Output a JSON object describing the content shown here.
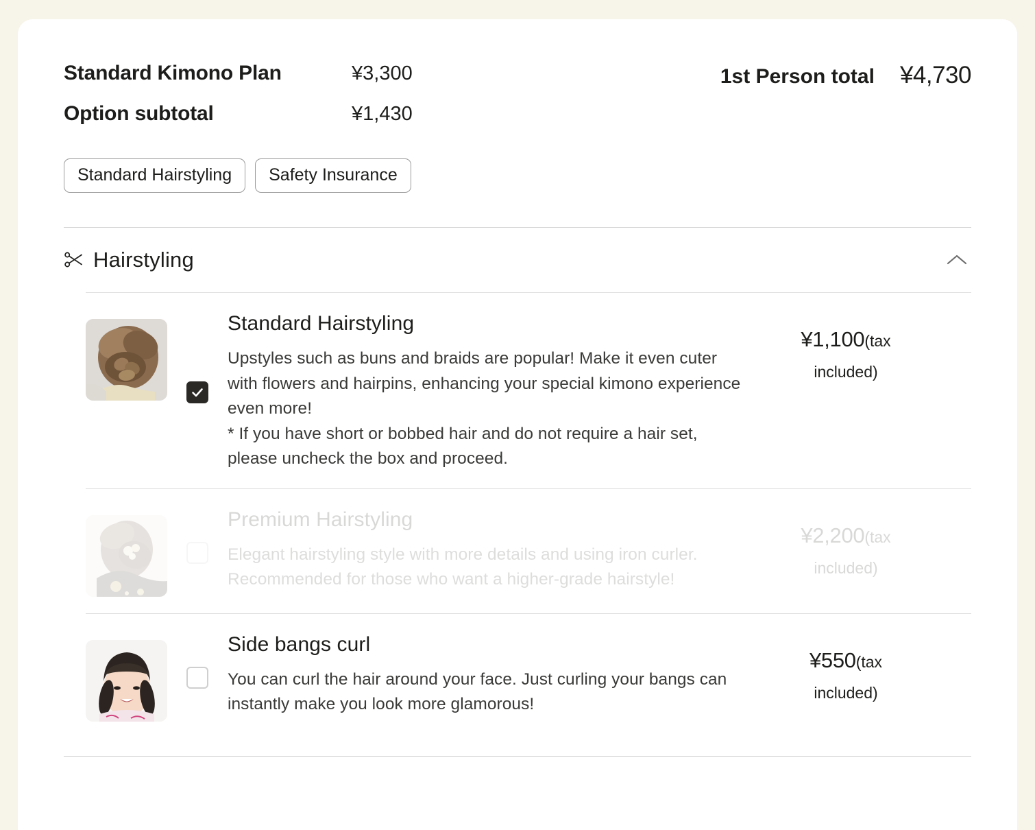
{
  "summary": {
    "plan_label": "Standard Kimono Plan",
    "plan_price": "¥3,300",
    "option_label": "Option subtotal",
    "option_price": "¥1,430",
    "total_label": "1st Person total",
    "total_price": "¥4,730"
  },
  "chips": [
    {
      "label": "Standard Hairstyling"
    },
    {
      "label": "Safety Insurance"
    }
  ],
  "section": {
    "icon": "scissors-icon",
    "title": "Hairstyling",
    "toggle_icon": "chevron-up-icon"
  },
  "options": [
    {
      "id": "standard-hairstyling",
      "title": "Standard Hairstyling",
      "description": "Upstyles such as buns and braids are popular! Make it even cuter with flowers and hairpins, enhancing your special kimono experience even more!\n* If you have short or bobbed hair and do not require a hair set, please uncheck the box and proceed.",
      "price": "¥1,100",
      "price_tax_part1": "(tax",
      "price_tax_part2": "included)",
      "checked": true,
      "disabled": false,
      "thumb_alt": "braided-updo-photo"
    },
    {
      "id": "premium-hairstyling",
      "title": "Premium Hairstyling",
      "description": "Elegant hairstyling style with more details and using iron curler. Recommended for those who want a higher-grade hairstyle!",
      "price": "¥2,200",
      "price_tax_part1": "(tax",
      "price_tax_part2": "included)",
      "checked": false,
      "disabled": true,
      "thumb_alt": "floral-updo-photo"
    },
    {
      "id": "side-bangs-curl",
      "title": "Side bangs curl",
      "description": "You can curl the hair around your face. Just curling your bangs can instantly make you look more glamorous!",
      "price": "¥550",
      "price_tax_part1": "(tax",
      "price_tax_part2": "included)",
      "checked": false,
      "disabled": false,
      "thumb_alt": "smiling-girl-bangs-photo"
    }
  ],
  "colors": {
    "page_background": "#f7f4e9",
    "card_background": "#ffffff",
    "text_primary": "#1d1d1b",
    "checkbox_checked": "#2b2926",
    "rule": "#d3d3d3"
  }
}
